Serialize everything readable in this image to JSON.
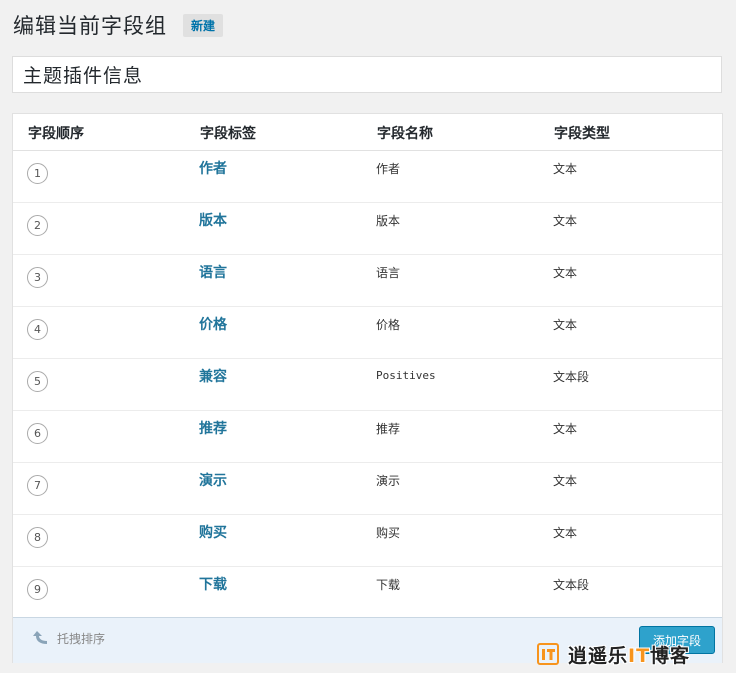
{
  "header": {
    "title": "编辑当前字段组",
    "new_label": "新建"
  },
  "group_title": {
    "value": "主题插件信息"
  },
  "table": {
    "columns": [
      "字段顺序",
      "字段标签",
      "字段名称",
      "字段类型"
    ],
    "rows": [
      {
        "order": "1",
        "label": "作者",
        "name": "作者",
        "type": "文本"
      },
      {
        "order": "2",
        "label": "版本",
        "name": "版本",
        "type": "文本"
      },
      {
        "order": "3",
        "label": "语言",
        "name": "语言",
        "type": "文本"
      },
      {
        "order": "4",
        "label": "价格",
        "name": "价格",
        "type": "文本"
      },
      {
        "order": "5",
        "label": "兼容",
        "name": "Positives",
        "type": "文本段"
      },
      {
        "order": "6",
        "label": "推荐",
        "name": "推荐",
        "type": "文本"
      },
      {
        "order": "7",
        "label": "演示",
        "name": "演示",
        "type": "文本"
      },
      {
        "order": "8",
        "label": "购买",
        "name": "购买",
        "type": "文本"
      },
      {
        "order": "9",
        "label": "下载",
        "name": "下载",
        "type": "文本段"
      }
    ]
  },
  "footer": {
    "sort_hint": "托拽排序",
    "sort_icon": "curved-arrow-up-icon",
    "add_field_label": "添加字段"
  },
  "watermark": {
    "text_before": "逍遥乐",
    "text_accent": "IT",
    "text_after": "博客"
  },
  "colors": {
    "link": "#21759b",
    "button": "#2ea2cc",
    "footer_bg": "#eaf2fa",
    "watermark_accent": "#f7941d"
  }
}
